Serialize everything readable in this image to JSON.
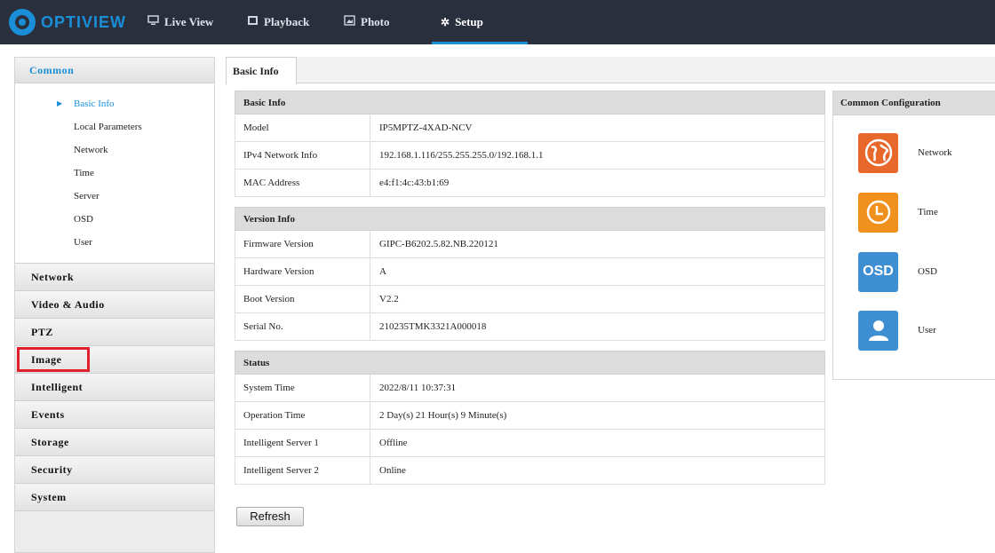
{
  "app": {
    "logo_text": "OPTIVIEW"
  },
  "nav": {
    "live_view": "Live View",
    "playback": "Playback",
    "photo": "Photo",
    "setup": "Setup"
  },
  "sidebar": {
    "common_label": "Common",
    "common_items": [
      {
        "label": "Basic Info"
      },
      {
        "label": "Local Parameters"
      },
      {
        "label": "Network"
      },
      {
        "label": "Time"
      },
      {
        "label": "Server"
      },
      {
        "label": "OSD"
      },
      {
        "label": "User"
      }
    ],
    "items": [
      {
        "label": "Network"
      },
      {
        "label": "Video & Audio"
      },
      {
        "label": "PTZ"
      },
      {
        "label": "Image"
      },
      {
        "label": "Intelligent"
      },
      {
        "label": "Events"
      },
      {
        "label": "Storage"
      },
      {
        "label": "Security"
      },
      {
        "label": "System"
      }
    ]
  },
  "tabs": {
    "basic_info": "Basic Info"
  },
  "basic_info": {
    "title": "Basic Info",
    "rows": [
      {
        "key": "Model",
        "value": "IP5MPTZ-4XAD-NCV"
      },
      {
        "key": "IPv4 Network Info",
        "value": "192.168.1.116/255.255.255.0/192.168.1.1"
      },
      {
        "key": "MAC Address",
        "value": "e4:f1:4c:43:b1:69"
      }
    ]
  },
  "version_info": {
    "title": "Version Info",
    "rows": [
      {
        "key": "Firmware Version",
        "value": "GIPC-B6202.5.82.NB.220121"
      },
      {
        "key": "Hardware Version",
        "value": "A"
      },
      {
        "key": "Boot Version",
        "value": "V2.2"
      },
      {
        "key": "Serial No.",
        "value": "210235TMK3321A000018"
      }
    ]
  },
  "status": {
    "title": "Status",
    "rows": [
      {
        "key": "System Time",
        "value": "2022/8/11 10:37:31"
      },
      {
        "key": "Operation Time",
        "value": "2 Day(s) 21 Hour(s) 9 Minute(s)"
      },
      {
        "key": "Intelligent Server 1",
        "value": "Offline"
      },
      {
        "key": "Intelligent Server 2",
        "value": "Online"
      }
    ]
  },
  "refresh_label": "Refresh",
  "common_config": {
    "title": "Common Configuration",
    "items": [
      {
        "label": "Network",
        "icon": "globe-icon",
        "color": "#e8672b"
      },
      {
        "label": "Time",
        "icon": "clock-icon",
        "color": "#f0911e"
      },
      {
        "label": "OSD",
        "icon": "osd-icon",
        "icon_text": "OSD",
        "color": "#3d8fd1"
      },
      {
        "label": "User",
        "icon": "user-icon",
        "color": "#3d8fd1"
      }
    ]
  },
  "colors": {
    "accent": "#1a8fd8",
    "topbar": "#2a2f3d",
    "highlight": "#e0202a"
  }
}
